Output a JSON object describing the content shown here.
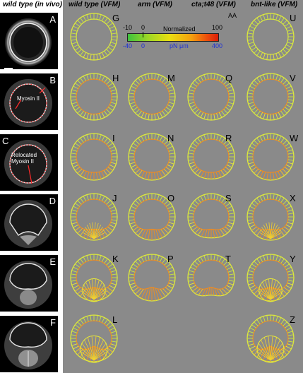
{
  "columns": {
    "wild_type_in_vivo": "wild type (in vivo)",
    "wild_type_vfm": "wild type (VFM)",
    "arm_vfm": "arm (VFM)",
    "cta_t48_vfm": "cta;t48 (VFM)",
    "bnt_like_vfm": "bnt-like (VFM)"
  },
  "microscopy_panels": [
    {
      "letter": "A"
    },
    {
      "letter": "B",
      "annotation": "Myosin II"
    },
    {
      "letter": "C",
      "annotation_line1": "Relocated",
      "annotation_line2": "Myosin II"
    },
    {
      "letter": "D"
    },
    {
      "letter": "E"
    },
    {
      "letter": "F"
    }
  ],
  "scale_bar": {
    "label": "20μm"
  },
  "legend": {
    "label_top_left": "-10",
    "label_top_zero": "0",
    "label_normalized": "Normalized",
    "label_top_right": "100",
    "label_bottom_left": "-40",
    "label_bottom_zero": "0",
    "label_units": "pN  μm",
    "label_bottom_right": "400",
    "panel_letter": "AA"
  },
  "vfm_panels": {
    "wild_type": [
      "G",
      "H",
      "I",
      "J",
      "K",
      "L"
    ],
    "arm": [
      "M",
      "N",
      "O",
      "P"
    ],
    "cta_t48": [
      "Q",
      "R",
      "S",
      "T"
    ],
    "bnt_like": [
      "U",
      "V",
      "W",
      "X",
      "Y",
      "Z"
    ]
  },
  "colors": {
    "background_gray": "#8a8a8a",
    "mesh_yellow": "#e8e83a",
    "mesh_green": "#b8e04a",
    "mesh_orange": "#f08a20",
    "arrow_red": "#e01b1b",
    "legend_blue": "#1c2fd8"
  }
}
